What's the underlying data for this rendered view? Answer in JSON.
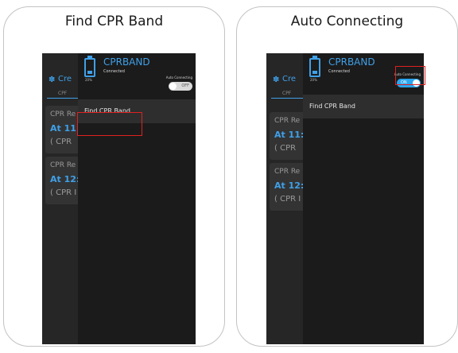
{
  "left_panel": {
    "title": "Find CPR Band",
    "background": {
      "header_text": "Cre",
      "tab_text": "CPF",
      "cards": [
        {
          "title": "CPR Re",
          "time": "At 11:",
          "sub": "( CPR"
        },
        {
          "title": "CPR Re",
          "time": "At 12:",
          "sub": "( CPR I"
        }
      ]
    },
    "drawer": {
      "battery_percent": "20%",
      "device_name": "CPRBAND",
      "status": "Connected",
      "auto_connect_label": "Auto Connecting",
      "toggle_text": "OFF",
      "menu_item": "Find CPR Band"
    }
  },
  "right_panel": {
    "title": "Auto Connecting",
    "background": {
      "header_text": "Cre",
      "tab_text": "CPF",
      "cards": [
        {
          "title": "CPR Re",
          "time": "At 11:",
          "sub": "( CPR"
        },
        {
          "title": "CPR Re",
          "time": "At 12:",
          "sub": "( CPR I"
        }
      ]
    },
    "drawer": {
      "battery_percent": "20%",
      "device_name": "CPRBAND",
      "status": "Connected",
      "auto_connect_label": "Auto Connecting",
      "toggle_text": "ON",
      "menu_item": "Find CPR Band"
    }
  },
  "colors": {
    "accent": "#3fa0e8",
    "highlight": "#e02020",
    "toggle_on": "#29a6f0",
    "drawer_bg": "#1b1b1b",
    "app_bg": "#262626"
  },
  "icons": {
    "header_icon": "gear-icon",
    "battery_icon": "battery-icon"
  }
}
